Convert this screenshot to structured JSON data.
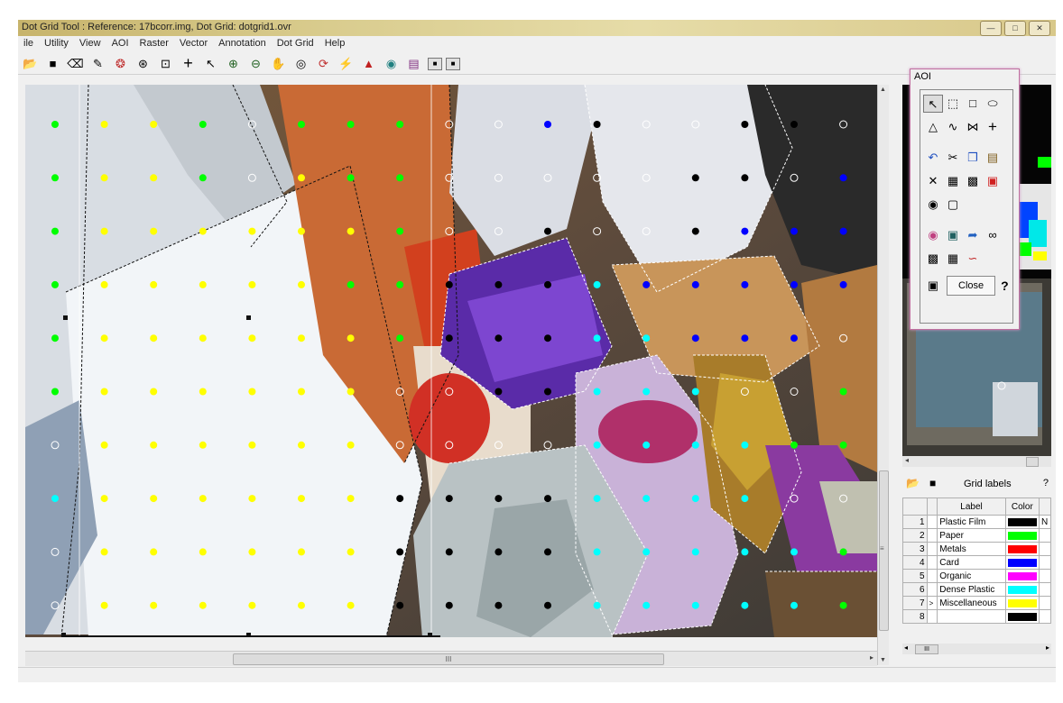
{
  "window": {
    "title": "Dot Grid Tool : Reference: 17bcorr.img, Dot Grid: dotgrid1.ovr",
    "buttons": [
      "minimize-icon",
      "maximize-icon",
      "close-icon"
    ]
  },
  "menu": [
    "ile",
    "Utility",
    "View",
    "AOI",
    "Raster",
    "Vector",
    "Annotation",
    "Dot Grid",
    "Help"
  ],
  "toolbar": [
    "open-icon",
    "save-icon",
    "eraser-icon",
    "pencil-icon",
    "color-wheel-icon",
    "shrink-icon",
    "fit-icon",
    "crosshair-icon",
    "pointer-icon",
    "zoom-in-icon",
    "zoom-out-icon",
    "pan-hand-icon",
    "grid-icon",
    "refresh-icon",
    "lightning-icon",
    "mountain-icon",
    "globe-icon",
    "chart-icon",
    "view-single-icon",
    "view-dual-icon"
  ],
  "colors": {
    "black": "#000000",
    "green": "#00ff00",
    "red": "#ff0000",
    "blue": "#0000ff",
    "magenta": "#ff00ff",
    "cyan": "#00ffff",
    "yellow": "#ffff00",
    "white": "#ffffff"
  },
  "dot_grid": {
    "rows": [
      [
        "g",
        "y",
        "y",
        "g",
        "w",
        "g",
        "g",
        "g",
        "w",
        "w",
        "b",
        "k",
        "w",
        "w",
        "k",
        "k",
        "w",
        "w"
      ],
      [
        "g",
        "y",
        "y",
        "g",
        "w",
        "y",
        "g",
        "g",
        "w",
        "w",
        "w",
        "w",
        "w",
        "k",
        "k",
        "w",
        "b",
        "w"
      ],
      [
        "g",
        "y",
        "y",
        "y",
        "y",
        "y",
        "y",
        "g",
        "w",
        "w",
        "k",
        "w",
        "w",
        "k",
        "b",
        "b",
        "b",
        "b"
      ],
      [
        "g",
        "y",
        "y",
        "y",
        "y",
        "y",
        "g",
        "g",
        "k",
        "k",
        "k",
        "c",
        "b",
        "b",
        "b",
        "b",
        "b",
        "b"
      ],
      [
        "g",
        "y",
        "y",
        "y",
        "y",
        "y",
        "y",
        "g",
        "k",
        "k",
        "k",
        "c",
        "c",
        "b",
        "b",
        "b",
        "w",
        "g"
      ],
      [
        "g",
        "y",
        "y",
        "y",
        "y",
        "y",
        "y",
        "w",
        "w",
        "k",
        "k",
        "c",
        "c",
        "c",
        "w",
        "w",
        "g",
        "g"
      ],
      [
        "w",
        "y",
        "y",
        "y",
        "y",
        "y",
        "y",
        "w",
        "w",
        "w",
        "w",
        "c",
        "c",
        "c",
        "c",
        "g",
        "g",
        "g"
      ],
      [
        "c",
        "y",
        "y",
        "y",
        "y",
        "y",
        "y",
        "k",
        "k",
        "k",
        "k",
        "c",
        "c",
        "c",
        "c",
        "w",
        "w",
        "g"
      ],
      [
        "w",
        "y",
        "y",
        "y",
        "y",
        "y",
        "y",
        "k",
        "k",
        "k",
        "k",
        "c",
        "c",
        "c",
        "c",
        "c",
        "g",
        "g"
      ],
      [
        "w",
        "y",
        "y",
        "y",
        "y",
        "y",
        "y",
        "k",
        "k",
        "k",
        "k",
        "c",
        "c",
        "c",
        "c",
        "c",
        "g",
        "w"
      ]
    ]
  },
  "grid_panel": {
    "title": "Grid labels",
    "help": "?",
    "headers": {
      "label": "Label",
      "color": "Color"
    },
    "rows": [
      {
        "num": "1",
        "pointer": "",
        "label": "Plastic Film",
        "color": "#000000",
        "extra": "N"
      },
      {
        "num": "2",
        "pointer": "",
        "label": "Paper",
        "color": "#00ff00",
        "extra": ""
      },
      {
        "num": "3",
        "pointer": "",
        "label": "Metals",
        "color": "#ff0000",
        "extra": ""
      },
      {
        "num": "4",
        "pointer": "",
        "label": "Card",
        "color": "#0000ff",
        "extra": ""
      },
      {
        "num": "5",
        "pointer": "",
        "label": "Organic",
        "color": "#ff00ff",
        "extra": ""
      },
      {
        "num": "6",
        "pointer": "",
        "label": "Dense Plastic",
        "color": "#00ffff",
        "extra": ""
      },
      {
        "num": "7",
        "pointer": ">",
        "label": "Miscellaneous",
        "color": "#ffff00",
        "extra": ""
      },
      {
        "num": "8",
        "pointer": "",
        "label": "",
        "color": "#000000",
        "extra": ""
      }
    ],
    "scroll_grip": "III"
  },
  "aoi": {
    "title": "AOI",
    "close_label": "Close",
    "help": "?",
    "tools": [
      [
        "pointer-icon",
        "dashed-rect-icon",
        "rect-icon",
        "ellipse-icon"
      ],
      [
        "polygon-icon",
        "polyline-icon",
        "magic-wand-icon",
        "point-icon"
      ],
      [
        "undo-icon",
        "cut-icon",
        "copy-icon",
        "paste-icon"
      ],
      [
        "reshape-icon",
        "union-icon",
        "intersect-icon",
        "delete-aoi-icon"
      ],
      [
        "aoi-link-icon",
        "aoi-frame-icon"
      ],
      [
        "color-aoi-icon",
        "inquire-icon",
        "grow-icon",
        "chain-icon"
      ],
      [
        "import-icon",
        "export-icon",
        "edit-curve-icon"
      ]
    ],
    "lock": "lock-icon"
  },
  "main_scroll": {
    "grip": "III"
  }
}
